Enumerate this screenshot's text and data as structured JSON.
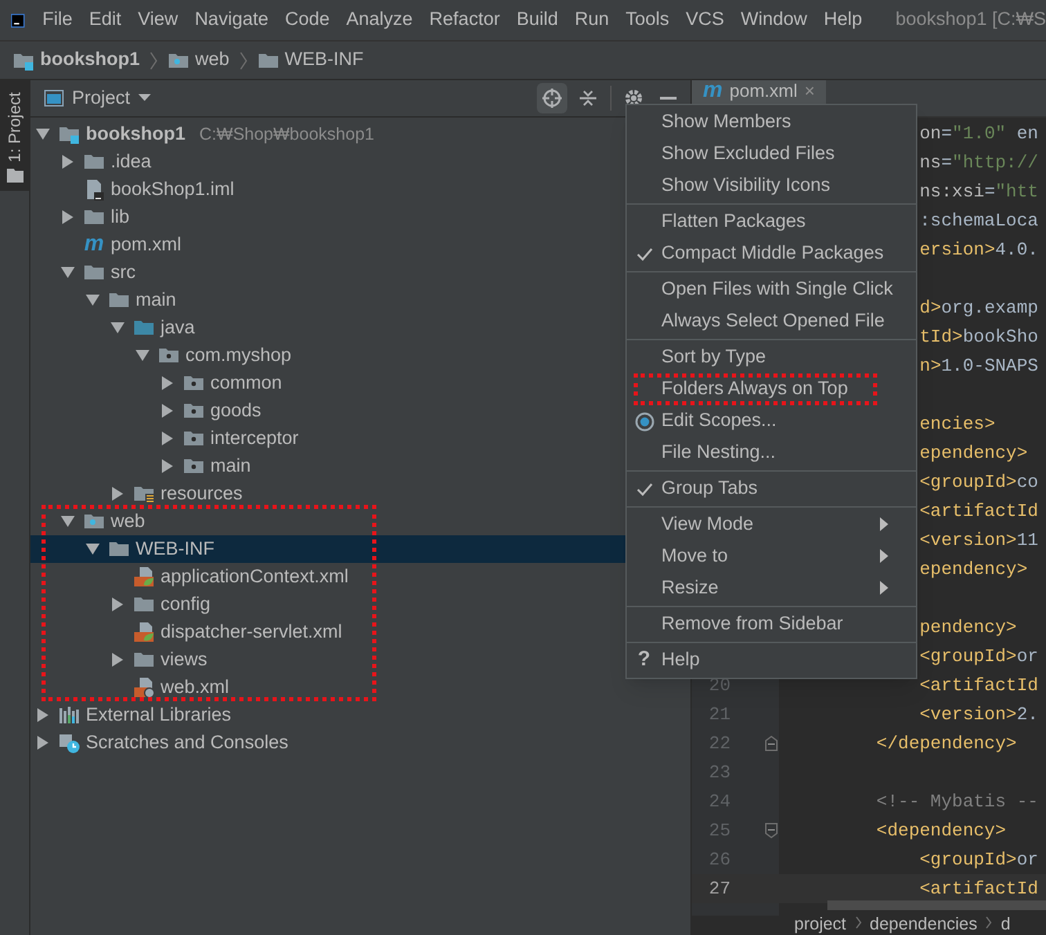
{
  "window": {
    "title": "bookshop1 [C:₩S"
  },
  "menu_bar": [
    "File",
    "Edit",
    "View",
    "Navigate",
    "Code",
    "Analyze",
    "Refactor",
    "Build",
    "Run",
    "Tools",
    "VCS",
    "Window",
    "Help"
  ],
  "breadcrumbs": [
    {
      "label": "bookshop1",
      "kind": "module"
    },
    {
      "label": "web",
      "kind": "web"
    },
    {
      "label": "WEB-INF",
      "kind": "folder"
    }
  ],
  "tool_strip": {
    "label": "1: Project",
    "selected": true
  },
  "project_panel": {
    "title": "Project",
    "tree": [
      {
        "label": "bookshop1",
        "path": "C:₩Shop₩bookshop1",
        "kind": "module",
        "expanded": true,
        "selected": false,
        "highlighted": false,
        "children": [
          {
            "label": ".idea",
            "kind": "folder",
            "expanded": false,
            "selected": false,
            "highlighted": false
          },
          {
            "label": "bookShop1.iml",
            "kind": "iml",
            "selected": false,
            "highlighted": false
          },
          {
            "label": "lib",
            "kind": "folder",
            "expanded": false,
            "selected": false,
            "highlighted": false
          },
          {
            "label": "pom.xml",
            "kind": "maven",
            "icon_text": "m",
            "selected": false,
            "highlighted": false
          },
          {
            "label": "src",
            "kind": "folder",
            "expanded": true,
            "selected": false,
            "highlighted": false,
            "children": [
              {
                "label": "main",
                "kind": "folder",
                "expanded": true,
                "selected": false,
                "highlighted": false,
                "children": [
                  {
                    "label": "java",
                    "kind": "source",
                    "expanded": true,
                    "selected": false,
                    "highlighted": false,
                    "children": [
                      {
                        "label": "com.myshop",
                        "kind": "package",
                        "expanded": true,
                        "selected": false,
                        "highlighted": false,
                        "children": [
                          {
                            "label": "common",
                            "kind": "package",
                            "expanded": false,
                            "selected": false,
                            "highlighted": false
                          },
                          {
                            "label": "goods",
                            "kind": "package",
                            "expanded": false,
                            "selected": false,
                            "highlighted": false
                          },
                          {
                            "label": "interceptor",
                            "kind": "package",
                            "expanded": false,
                            "selected": false,
                            "highlighted": false
                          },
                          {
                            "label": "main",
                            "kind": "package",
                            "expanded": false,
                            "selected": false,
                            "highlighted": false
                          }
                        ]
                      }
                    ]
                  },
                  {
                    "label": "resources",
                    "kind": "resources",
                    "expanded": false,
                    "selected": false,
                    "highlighted": false
                  }
                ]
              }
            ]
          },
          {
            "label": "web",
            "kind": "web",
            "expanded": true,
            "selected": false,
            "highlighted": true,
            "children": [
              {
                "label": "WEB-INF",
                "kind": "folder",
                "expanded": true,
                "selected": true,
                "highlighted": false,
                "children": [
                  {
                    "label": "applicationContext.xml",
                    "kind": "spring",
                    "selected": false,
                    "highlighted": false
                  },
                  {
                    "label": "config",
                    "kind": "folder",
                    "expanded": false,
                    "selected": false,
                    "highlighted": false
                  },
                  {
                    "label": "dispatcher-servlet.xml",
                    "kind": "spring",
                    "selected": false,
                    "highlighted": false
                  },
                  {
                    "label": "views",
                    "kind": "folder",
                    "expanded": false,
                    "selected": false,
                    "highlighted": false
                  },
                  {
                    "label": "web.xml",
                    "kind": "webxml",
                    "selected": false,
                    "highlighted": false
                  }
                ]
              }
            ]
          }
        ]
      },
      {
        "label": "External Libraries",
        "kind": "libraries",
        "expanded": false,
        "selected": false,
        "highlighted": false
      },
      {
        "label": "Scratches and Consoles",
        "kind": "scratches",
        "expanded": false,
        "selected": false,
        "highlighted": false
      }
    ]
  },
  "editor": {
    "tab": {
      "label": "pom.xml",
      "icon_text": "m",
      "close": "×"
    },
    "lines": [
      {
        "kind": "plain",
        "text": "            on=\"1.0\" en"
      },
      {
        "kind": "plain",
        "text": "            ns=\"http://"
      },
      {
        "kind": "plain",
        "text": "            ns:xsi=\"htt"
      },
      {
        "kind": "plain",
        "text": "            :schemaLoca"
      },
      {
        "kind": "plain",
        "text": "            ersion>4.0."
      },
      {
        "kind": "plain"
      },
      {
        "kind": "plain",
        "text": "            d>org.examp"
      },
      {
        "kind": "plain",
        "text": "            tId>bookSho"
      },
      {
        "kind": "plain",
        "text": "            n>1.0-SNAPS"
      },
      {
        "kind": "plain"
      },
      {
        "kind": "plain",
        "text": "            encies>"
      },
      {
        "kind": "plain",
        "text": "            ependency>"
      },
      {
        "kind": "plain",
        "text": "            <groupId>co"
      },
      {
        "kind": "plain",
        "text": "            <artifactId"
      },
      {
        "kind": "plain",
        "text": "            <version>11"
      },
      {
        "kind": "plain",
        "text": "            ependency>"
      },
      {
        "kind": "plain"
      },
      {
        "kind": "plain",
        "text": "            pendency>"
      },
      {
        "kind": "plain",
        "text": "            <groupId>or"
      },
      {
        "kind": "plain",
        "text": "            <artifactId",
        "number": "20",
        "current": false
      },
      {
        "kind": "plain",
        "text": "            <version>2.",
        "number": "21",
        "current": false
      },
      {
        "kind": "fold-end",
        "text": "        </dependency>",
        "number": "22",
        "current": false
      },
      {
        "kind": "plain",
        "number": "23",
        "current": false
      },
      {
        "kind": "plain",
        "text": "        <!-- Mybatis --",
        "number": "24",
        "current": false
      },
      {
        "kind": "fold-start",
        "text": "        <dependency>",
        "number": "25",
        "current": false
      },
      {
        "kind": "plain",
        "text": "            <groupId>or",
        "number": "26",
        "current": false
      },
      {
        "kind": "plain",
        "text": "            <artifactId",
        "number": "27",
        "current": true
      }
    ],
    "breadcrumbs": [
      "project",
      "dependencies",
      "d"
    ]
  },
  "context_menu": {
    "sections": [
      [
        {
          "label": "Show Members",
          "kind": "plain",
          "checked": false,
          "submenu": false,
          "highlighted": false
        },
        {
          "label": "Show Excluded Files",
          "kind": "plain",
          "checked": false,
          "submenu": false,
          "highlighted": false
        },
        {
          "label": "Show Visibility Icons",
          "kind": "plain",
          "checked": false,
          "submenu": false,
          "highlighted": false
        }
      ],
      [
        {
          "label": "Flatten Packages",
          "kind": "plain",
          "checked": false,
          "submenu": false,
          "highlighted": false
        },
        {
          "label": "Compact Middle Packages",
          "kind": "plain",
          "checked": true,
          "submenu": false,
          "highlighted": false
        }
      ],
      [
        {
          "label": "Open Files with Single Click",
          "kind": "plain",
          "checked": false,
          "submenu": false,
          "highlighted": false
        },
        {
          "label": "Always Select Opened File",
          "kind": "plain",
          "checked": false,
          "submenu": false,
          "highlighted": false
        }
      ],
      [
        {
          "label": "Sort by Type",
          "kind": "plain",
          "checked": false,
          "submenu": false,
          "highlighted": false
        },
        {
          "label": "Folders Always on Top",
          "kind": "plain",
          "checked": false,
          "submenu": false,
          "highlighted": true
        },
        {
          "label": "Edit Scopes...",
          "kind": "scopes",
          "checked": false,
          "submenu": false,
          "highlighted": false
        },
        {
          "label": "File Nesting...",
          "kind": "plain",
          "checked": false,
          "submenu": false,
          "highlighted": false
        }
      ],
      [
        {
          "label": "Group Tabs",
          "kind": "plain",
          "checked": true,
          "submenu": false,
          "highlighted": false
        }
      ],
      [
        {
          "label": "View Mode",
          "kind": "plain",
          "checked": false,
          "submenu": true,
          "highlighted": false
        },
        {
          "label": "Move to",
          "kind": "plain",
          "checked": false,
          "submenu": true,
          "highlighted": false
        },
        {
          "label": "Resize",
          "kind": "plain",
          "checked": false,
          "submenu": true,
          "highlighted": false
        }
      ],
      [
        {
          "label": "Remove from Sidebar",
          "kind": "plain",
          "checked": false,
          "submenu": false,
          "highlighted": false
        }
      ],
      [
        {
          "label": "Help",
          "kind": "help",
          "glyph": "?",
          "checked": false,
          "submenu": false,
          "highlighted": false
        }
      ]
    ]
  }
}
